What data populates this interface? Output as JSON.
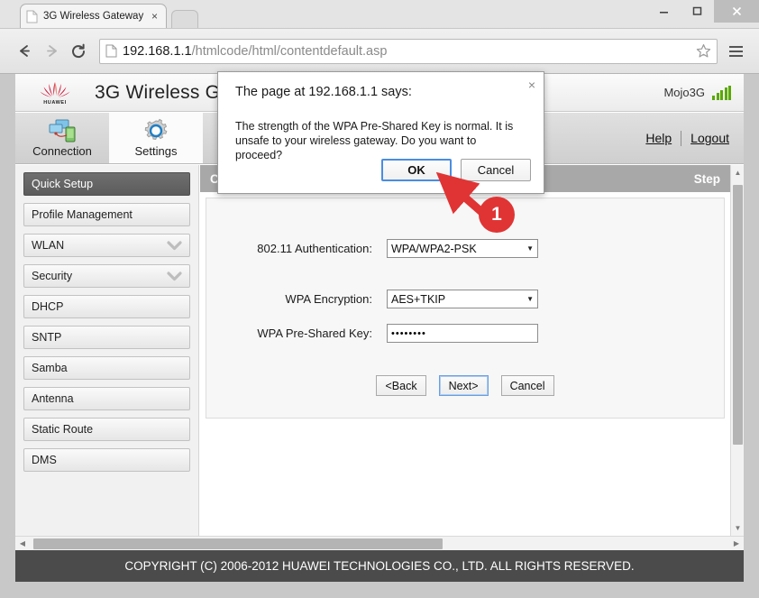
{
  "browser": {
    "tab": {
      "title": "3G Wireless Gateway",
      "close_label": "×",
      "favicon": "page-icon"
    },
    "window_controls": {
      "minimize": "–",
      "maximize": "□",
      "close": "✕"
    },
    "toolbar": {
      "back": "←",
      "forward": "→",
      "reload": "C",
      "url_host": "192.168.1.1",
      "url_path": "/htmlcode/html/contentdefault.asp",
      "bookmark": "☆",
      "menu": "menu-icon"
    }
  },
  "page": {
    "header": {
      "brand": "HUAWEI",
      "title": "3G Wireless Gateway",
      "device_name": "Mojo3G",
      "signal_icon": "signal-bars-icon"
    },
    "tabs": [
      {
        "label": "Connection",
        "icon": "connection-icon",
        "active": false
      },
      {
        "label": "Settings",
        "icon": "gear-icon",
        "active": true
      }
    ],
    "links": [
      {
        "label": "Help"
      },
      {
        "label": "Logout"
      }
    ],
    "sidebar": [
      {
        "label": "Quick Setup",
        "active": true,
        "expandable": false
      },
      {
        "label": "Profile Management",
        "active": false,
        "expandable": false
      },
      {
        "label": "WLAN",
        "active": false,
        "expandable": true
      },
      {
        "label": "Security",
        "active": false,
        "expandable": true
      },
      {
        "label": "DHCP",
        "active": false,
        "expandable": false
      },
      {
        "label": "SNTP",
        "active": false,
        "expandable": false
      },
      {
        "label": "Samba",
        "active": false,
        "expandable": false
      },
      {
        "label": "Antenna",
        "active": false,
        "expandable": false
      },
      {
        "label": "Static Route",
        "active": false,
        "expandable": false
      },
      {
        "label": "DMS",
        "active": false,
        "expandable": false
      }
    ],
    "content": {
      "header_left": "Con",
      "header_right": "Step",
      "fields": [
        {
          "label": "802.11 Authentication:",
          "value": "WPA/WPA2-PSK",
          "type": "select"
        },
        {
          "label": "WPA Encryption:",
          "value": "AES+TKIP",
          "type": "select"
        },
        {
          "label": "WPA Pre-Shared Key:",
          "value": "••••••••",
          "type": "password"
        }
      ],
      "buttons": [
        {
          "label": "<Back",
          "focused": false
        },
        {
          "label": "Next>",
          "focused": true
        },
        {
          "label": "Cancel",
          "focused": false
        }
      ]
    },
    "footer": "COPYRIGHT (C) 2006-2012 HUAWEI TECHNOLOGIES CO., LTD. ALL RIGHTS RESERVED."
  },
  "dialog": {
    "title": "The page at 192.168.1.1 says:",
    "message": "The strength of the WPA Pre-Shared Key is normal. It is unsafe to your wireless gateway. Do you want to proceed?",
    "close_label": "×",
    "buttons": [
      {
        "label": "OK",
        "primary": true
      },
      {
        "label": "Cancel",
        "primary": false
      }
    ]
  },
  "annotation": {
    "step_number": "1",
    "color": "#e03434"
  }
}
